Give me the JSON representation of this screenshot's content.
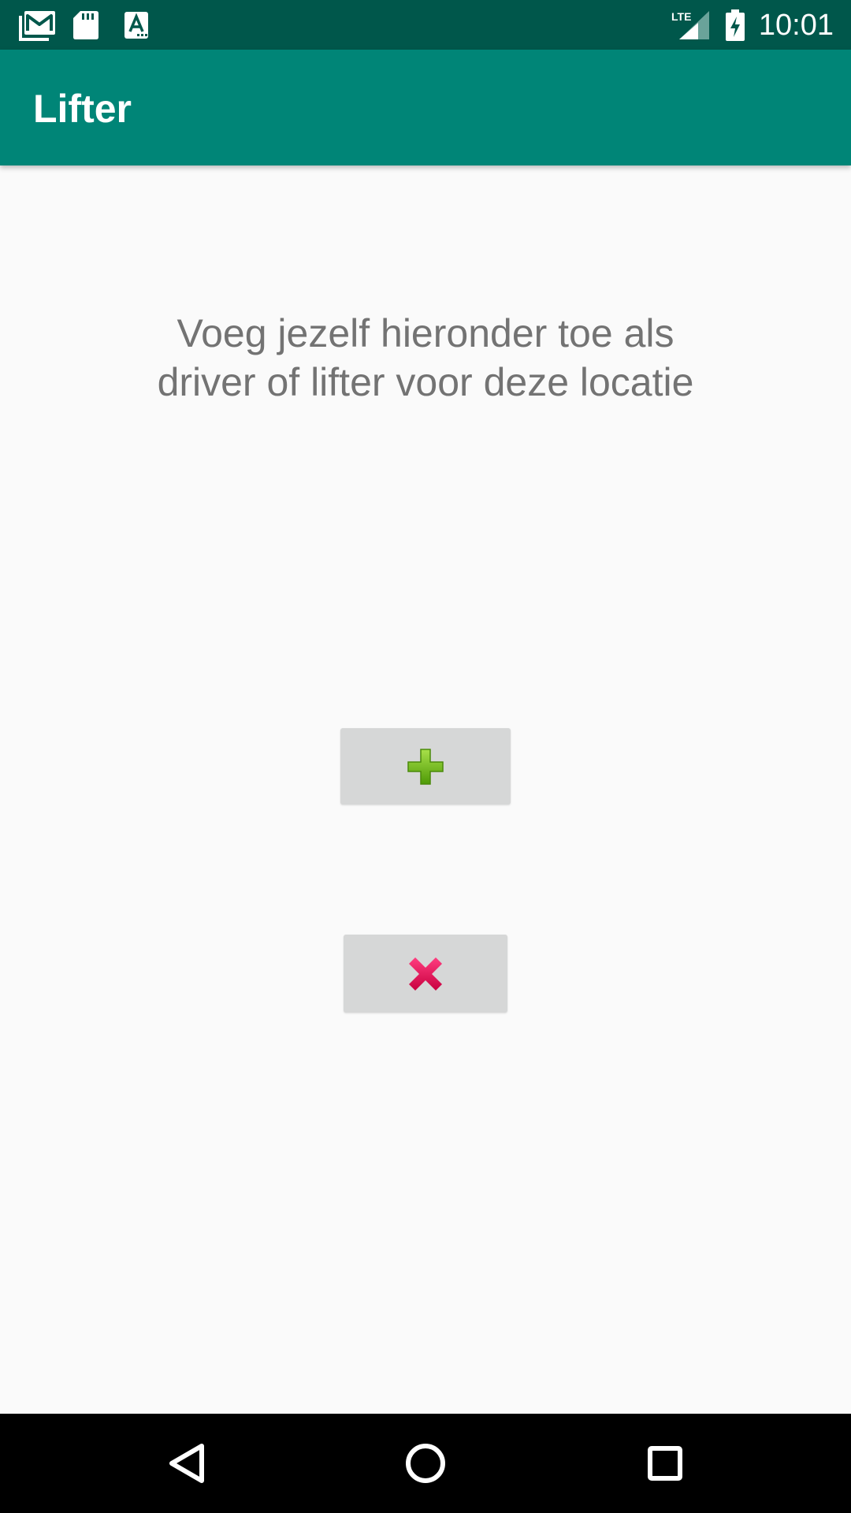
{
  "status_bar": {
    "time": "10:01",
    "network_label": "LTE",
    "icons": [
      "gmail-icon",
      "sd-card-icon",
      "text-a-icon",
      "lte-signal-icon",
      "battery-charging-icon"
    ]
  },
  "app_bar": {
    "title": "Lifter"
  },
  "main": {
    "message_line1": "Voeg jezelf hieronder toe als",
    "message_line2": "driver of lifter voor deze locatie",
    "add_button_icon": "plus-icon",
    "remove_button_icon": "close-icon"
  },
  "nav_bar": {
    "buttons": [
      "back-icon",
      "home-icon",
      "recents-icon"
    ]
  },
  "colors": {
    "status_bar": "#00574b",
    "app_bar": "#008577",
    "background": "#fafafa",
    "message_text": "#737373",
    "button_bg": "#d6d7d7",
    "plus_green": "#6cb300",
    "cross_red": "#e0115f"
  }
}
